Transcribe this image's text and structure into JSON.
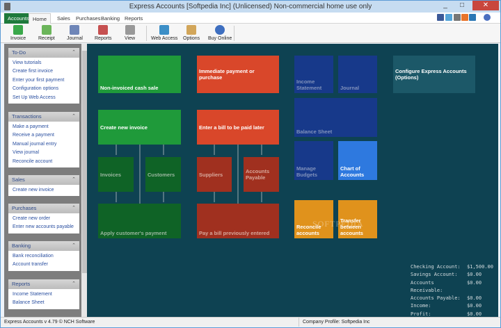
{
  "window": {
    "title": "Express Accounts [Softpedia Inc] (Unlicensed) Non-commercial home use only",
    "minimize": "_",
    "maximize": "□",
    "close": "✕"
  },
  "tabs": [
    "Accounts",
    "Home",
    "Sales",
    "Purchases",
    "Banking",
    "Reports"
  ],
  "toolbar": [
    "Invoice",
    "Receipt",
    "Journal",
    "Reports",
    "View",
    "Web Access",
    "Options",
    "Buy Online"
  ],
  "sidebar": [
    {
      "title": "To-Do",
      "links": [
        "View tutorials",
        "Create first invoice",
        "Enter your first payment",
        "Configuration options",
        "Set Up Web Access"
      ]
    },
    {
      "title": "Transactions",
      "links": [
        "Make a payment",
        "Receive a payment",
        "Manual journal entry",
        "View journal",
        "Reconcile account"
      ]
    },
    {
      "title": "Sales",
      "links": [
        "Create new invoice"
      ]
    },
    {
      "title": "Purchases",
      "links": [
        "Create new order",
        "Enter new accounts payable"
      ]
    },
    {
      "title": "Banking",
      "links": [
        "Bank reconciliation",
        "Account transfer"
      ]
    },
    {
      "title": "Reports",
      "links": [
        "Income Statement",
        "Balance Sheet"
      ]
    }
  ],
  "tiles": {
    "non_invoiced": "Non-invoiced cash sale",
    "immediate": "Immediate payment or purchase",
    "create_invoice": "Create new invoice",
    "invoices": "Invoices",
    "customers": "Customers",
    "apply_payment": "Apply customer's payment",
    "enter_bill": "Enter a bill to be paid later",
    "suppliers": "Suppliers",
    "accounts_payable": "Accounts Payable",
    "pay_bill": "Pay a bill previously entered",
    "income_statement": "Income Statement",
    "journal": "Journal",
    "balance_sheet": "Balance Sheet",
    "manage_budgets": "Manage Budgets",
    "chart_of_accounts": "Chart of Accounts",
    "configure": "Configure Express Accounts (Options)",
    "reconcile": "Reconcile accounts",
    "transfer": "Transfer between accounts"
  },
  "summary": [
    {
      "label": "Checking Account:",
      "value": "$1,500.00"
    },
    {
      "label": "Savings Account:",
      "value": "$0.00"
    },
    {
      "label": "Accounts Receivable:",
      "value": "$0.00"
    },
    {
      "label": "Accounts Payable:",
      "value": "$0.00"
    },
    {
      "label": "Income:",
      "value": "$0.00"
    },
    {
      "label": "Profit:",
      "value": "$0.00"
    }
  ],
  "status": {
    "version": "Express Accounts v 4.79 © NCH Software",
    "company": "Company Profile: Softpedia Inc"
  },
  "watermark": "SOFTPEDIA"
}
